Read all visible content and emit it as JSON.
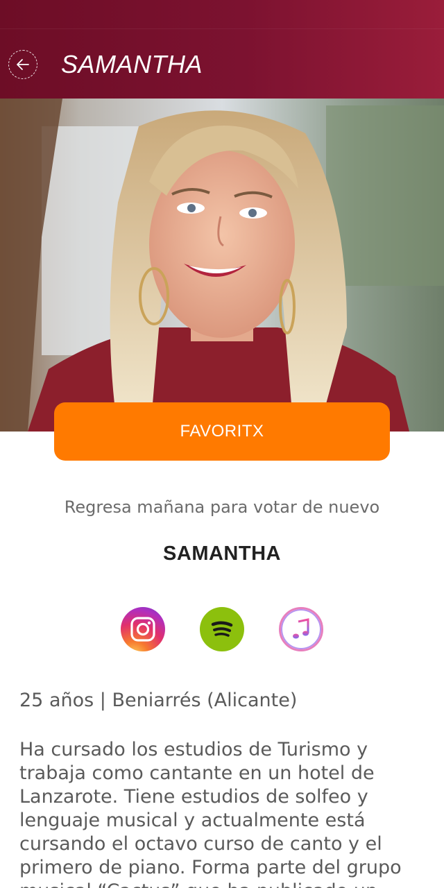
{
  "header": {
    "title": "SAMANTHA",
    "back_icon": "back-arrow-icon",
    "gradient": [
      "#6d0d26",
      "#9a1d3a"
    ]
  },
  "photo": {
    "subject": "smiling woman with long blonde hair, hoop earrings and red sweater"
  },
  "favorite_button": {
    "label": "FAVORITX",
    "color": "#ff7a00"
  },
  "vote_message": "Regresa mañana para votar de nuevo",
  "artist": {
    "name": "SAMANTHA",
    "meta": "25 años | Beniarrés (Alicante)",
    "bio": "Ha cursado los estudios de Turismo y trabaja como cantante en un hotel de Lanzarote. Tiene estudios de solfeo y lenguaje musical y actualmente está cursando el octavo curso de canto y el primero de piano. Forma parte del grupo musical “Cactus” que ha publicado un"
  },
  "social_links": [
    {
      "name": "instagram",
      "icon": "instagram-icon"
    },
    {
      "name": "spotify",
      "icon": "spotify-icon"
    },
    {
      "name": "apple-music",
      "icon": "apple-music-icon"
    }
  ]
}
